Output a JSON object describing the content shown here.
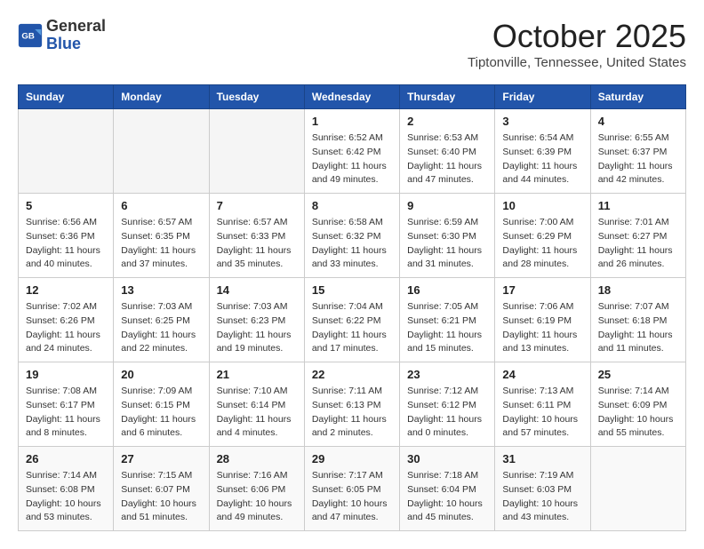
{
  "header": {
    "logo_general": "General",
    "logo_blue": "Blue",
    "month": "October 2025",
    "location": "Tiptonville, Tennessee, United States"
  },
  "days_of_week": [
    "Sunday",
    "Monday",
    "Tuesday",
    "Wednesday",
    "Thursday",
    "Friday",
    "Saturday"
  ],
  "weeks": [
    [
      {
        "num": "",
        "info": ""
      },
      {
        "num": "",
        "info": ""
      },
      {
        "num": "",
        "info": ""
      },
      {
        "num": "1",
        "info": "Sunrise: 6:52 AM\nSunset: 6:42 PM\nDaylight: 11 hours\nand 49 minutes."
      },
      {
        "num": "2",
        "info": "Sunrise: 6:53 AM\nSunset: 6:40 PM\nDaylight: 11 hours\nand 47 minutes."
      },
      {
        "num": "3",
        "info": "Sunrise: 6:54 AM\nSunset: 6:39 PM\nDaylight: 11 hours\nand 44 minutes."
      },
      {
        "num": "4",
        "info": "Sunrise: 6:55 AM\nSunset: 6:37 PM\nDaylight: 11 hours\nand 42 minutes."
      }
    ],
    [
      {
        "num": "5",
        "info": "Sunrise: 6:56 AM\nSunset: 6:36 PM\nDaylight: 11 hours\nand 40 minutes."
      },
      {
        "num": "6",
        "info": "Sunrise: 6:57 AM\nSunset: 6:35 PM\nDaylight: 11 hours\nand 37 minutes."
      },
      {
        "num": "7",
        "info": "Sunrise: 6:57 AM\nSunset: 6:33 PM\nDaylight: 11 hours\nand 35 minutes."
      },
      {
        "num": "8",
        "info": "Sunrise: 6:58 AM\nSunset: 6:32 PM\nDaylight: 11 hours\nand 33 minutes."
      },
      {
        "num": "9",
        "info": "Sunrise: 6:59 AM\nSunset: 6:30 PM\nDaylight: 11 hours\nand 31 minutes."
      },
      {
        "num": "10",
        "info": "Sunrise: 7:00 AM\nSunset: 6:29 PM\nDaylight: 11 hours\nand 28 minutes."
      },
      {
        "num": "11",
        "info": "Sunrise: 7:01 AM\nSunset: 6:27 PM\nDaylight: 11 hours\nand 26 minutes."
      }
    ],
    [
      {
        "num": "12",
        "info": "Sunrise: 7:02 AM\nSunset: 6:26 PM\nDaylight: 11 hours\nand 24 minutes."
      },
      {
        "num": "13",
        "info": "Sunrise: 7:03 AM\nSunset: 6:25 PM\nDaylight: 11 hours\nand 22 minutes."
      },
      {
        "num": "14",
        "info": "Sunrise: 7:03 AM\nSunset: 6:23 PM\nDaylight: 11 hours\nand 19 minutes."
      },
      {
        "num": "15",
        "info": "Sunrise: 7:04 AM\nSunset: 6:22 PM\nDaylight: 11 hours\nand 17 minutes."
      },
      {
        "num": "16",
        "info": "Sunrise: 7:05 AM\nSunset: 6:21 PM\nDaylight: 11 hours\nand 15 minutes."
      },
      {
        "num": "17",
        "info": "Sunrise: 7:06 AM\nSunset: 6:19 PM\nDaylight: 11 hours\nand 13 minutes."
      },
      {
        "num": "18",
        "info": "Sunrise: 7:07 AM\nSunset: 6:18 PM\nDaylight: 11 hours\nand 11 minutes."
      }
    ],
    [
      {
        "num": "19",
        "info": "Sunrise: 7:08 AM\nSunset: 6:17 PM\nDaylight: 11 hours\nand 8 minutes."
      },
      {
        "num": "20",
        "info": "Sunrise: 7:09 AM\nSunset: 6:15 PM\nDaylight: 11 hours\nand 6 minutes."
      },
      {
        "num": "21",
        "info": "Sunrise: 7:10 AM\nSunset: 6:14 PM\nDaylight: 11 hours\nand 4 minutes."
      },
      {
        "num": "22",
        "info": "Sunrise: 7:11 AM\nSunset: 6:13 PM\nDaylight: 11 hours\nand 2 minutes."
      },
      {
        "num": "23",
        "info": "Sunrise: 7:12 AM\nSunset: 6:12 PM\nDaylight: 11 hours\nand 0 minutes."
      },
      {
        "num": "24",
        "info": "Sunrise: 7:13 AM\nSunset: 6:11 PM\nDaylight: 10 hours\nand 57 minutes."
      },
      {
        "num": "25",
        "info": "Sunrise: 7:14 AM\nSunset: 6:09 PM\nDaylight: 10 hours\nand 55 minutes."
      }
    ],
    [
      {
        "num": "26",
        "info": "Sunrise: 7:14 AM\nSunset: 6:08 PM\nDaylight: 10 hours\nand 53 minutes."
      },
      {
        "num": "27",
        "info": "Sunrise: 7:15 AM\nSunset: 6:07 PM\nDaylight: 10 hours\nand 51 minutes."
      },
      {
        "num": "28",
        "info": "Sunrise: 7:16 AM\nSunset: 6:06 PM\nDaylight: 10 hours\nand 49 minutes."
      },
      {
        "num": "29",
        "info": "Sunrise: 7:17 AM\nSunset: 6:05 PM\nDaylight: 10 hours\nand 47 minutes."
      },
      {
        "num": "30",
        "info": "Sunrise: 7:18 AM\nSunset: 6:04 PM\nDaylight: 10 hours\nand 45 minutes."
      },
      {
        "num": "31",
        "info": "Sunrise: 7:19 AM\nSunset: 6:03 PM\nDaylight: 10 hours\nand 43 minutes."
      },
      {
        "num": "",
        "info": ""
      }
    ]
  ]
}
